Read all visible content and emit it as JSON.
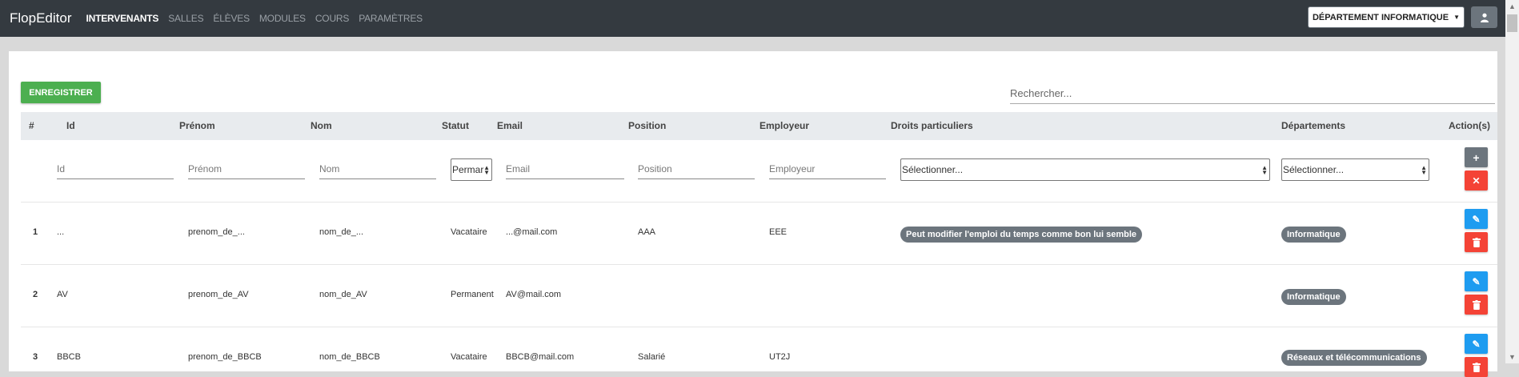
{
  "navbar": {
    "brand": "FlopEditor",
    "links": [
      "INTERVENANTS",
      "SALLES",
      "ÉLÈVES",
      "MODULES",
      "COURS",
      "PARAMÈTRES"
    ],
    "department_button": "DÉPARTEMENT INFORMATIQUE",
    "user_icon": "user-icon"
  },
  "toolbar": {
    "save_label": "ENREGISTRER",
    "search_placeholder": "Rechercher..."
  },
  "table": {
    "headers": [
      "#",
      "Id",
      "Prénom",
      "Nom",
      "Statut",
      "Email",
      "Position",
      "Employeur",
      "Droits particuliers",
      "Départements",
      "Action(s)"
    ],
    "filters": {
      "id": "Id",
      "prenom": "Prénom",
      "nom": "Nom",
      "statut": "Permar",
      "email": "Email",
      "position": "Position",
      "employeur": "Employeur",
      "droits": "Sélectionner...",
      "departements": "Sélectionner..."
    },
    "rows": [
      {
        "num": "1",
        "id": "...",
        "prenom": "prenom_de_...",
        "nom": "nom_de_...",
        "statut": "Vacataire",
        "email": "...@mail.com",
        "position": "AAA",
        "employeur": "EEE",
        "droits": "Peut modifier l'emploi du temps comme bon lui semble",
        "departement": "Informatique"
      },
      {
        "num": "2",
        "id": "AV",
        "prenom": "prenom_de_AV",
        "nom": "nom_de_AV",
        "statut": "Permanent",
        "email": "AV@mail.com",
        "position": "",
        "employeur": "",
        "droits": "",
        "departement": "Informatique"
      },
      {
        "num": "3",
        "id": "BBCB",
        "prenom": "prenom_de_BBCB",
        "nom": "nom_de_BBCB",
        "statut": "Vacataire",
        "email": "BBCB@mail.com",
        "position": "Salarié",
        "employeur": "UT2J",
        "droits": "",
        "departement": "Réseaux et télécommunications"
      }
    ]
  },
  "colors": {
    "navbar": "#343a40",
    "save": "#4caf50",
    "add": "#6c757d",
    "delete": "#f44336",
    "edit": "#1e9cf0",
    "badge": "#6c757d"
  }
}
